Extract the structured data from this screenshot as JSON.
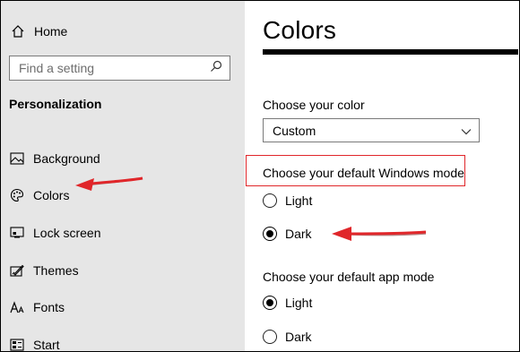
{
  "sidebar": {
    "home_label": "Home",
    "search_placeholder": "Find a setting",
    "section_title": "Personalization",
    "items": [
      {
        "label": "Background",
        "icon": "image-icon"
      },
      {
        "label": "Colors",
        "icon": "palette-icon"
      },
      {
        "label": "Lock screen",
        "icon": "lock-screen-icon"
      },
      {
        "label": "Themes",
        "icon": "themes-icon"
      },
      {
        "label": "Fonts",
        "icon": "fonts-icon"
      },
      {
        "label": "Start",
        "icon": "start-icon"
      }
    ]
  },
  "main": {
    "title": "Colors",
    "choose_color_label": "Choose your color",
    "choose_color_value": "Custom",
    "windows_mode_label": "Choose your default Windows mode",
    "windows_mode_options": [
      {
        "label": "Light",
        "selected": false
      },
      {
        "label": "Dark",
        "selected": true
      }
    ],
    "app_mode_label": "Choose your default app mode",
    "app_mode_options": [
      {
        "label": "Light",
        "selected": true
      },
      {
        "label": "Dark",
        "selected": false
      }
    ]
  },
  "colors": {
    "sidebar_bg": "#e6e6e6",
    "annotation_red": "#e0262a"
  }
}
